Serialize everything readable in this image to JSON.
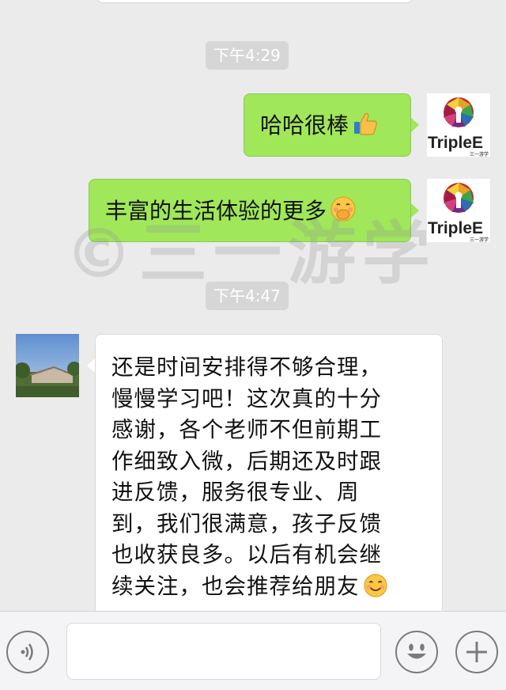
{
  "messages": {
    "time1": "下午4:29",
    "msg1_text": "哈哈很棒",
    "msg1_emoji": "thumbs-up-icon",
    "msg2_text": "丰富的生活体验的更多",
    "msg2_emoji": "face-hand-over-mouth-icon",
    "time2": "下午4:47",
    "msg3_lines": [
      "还是时间安排得不够合理，",
      "慢慢学习吧！这次真的十分",
      "感谢，各个老师不但前期工",
      "作细致入微，后期还及时跟",
      "进反馈，服务很专业、周",
      "到，我们很满意，孩子反馈",
      "也收获良多。以后有机会继",
      "续关注，也会推荐给朋友"
    ],
    "msg3_emoji": "smiling-face-icon"
  },
  "brand_avatar": {
    "name": "TripleE",
    "sub": "三一游学"
  },
  "watermark": "©三一游学",
  "colors": {
    "background": "#ebebeb",
    "bubble_green": "#a0e75a",
    "time_chip": "#d6d6d6"
  },
  "input": {
    "value": ""
  }
}
